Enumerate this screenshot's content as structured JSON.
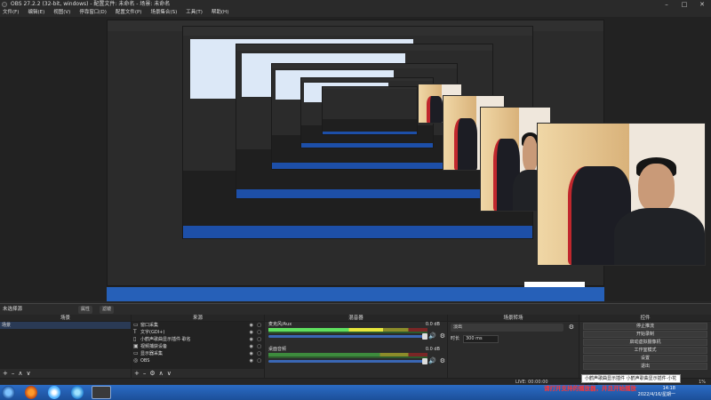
{
  "window": {
    "title": "OBS 27.2.2 (32-bit, windows) - 配置文件: 未命名 - 场景: 未命名"
  },
  "menu": [
    "文件(F)",
    "编辑(E)",
    "视图(V)",
    "停靠窗口(D)",
    "配置文件(P)",
    "场景集合(S)",
    "工具(T)",
    "帮助(H)"
  ],
  "scene_bar": {
    "current": "未选择源",
    "properties_label": "属性",
    "filters_label": "滤镜"
  },
  "scenes": {
    "title": "场景",
    "items": [
      "场景"
    ]
  },
  "sources": {
    "title": "来源",
    "items": [
      {
        "label": "窗口采集",
        "icon": "window-icon"
      },
      {
        "label": "文字(GDI+)",
        "icon": "text-icon"
      },
      {
        "label": "小鹤声歌曲显示插件·歌名",
        "icon": "text-icon"
      },
      {
        "label": "视频捕获设备",
        "icon": "camera-icon"
      },
      {
        "label": "显示器采集",
        "icon": "monitor-icon"
      },
      {
        "label": "OBS",
        "icon": "image-icon"
      }
    ]
  },
  "mixer": {
    "title": "混音器",
    "tracks": [
      {
        "name": "麦克风/Aux",
        "db": "0.0 dB",
        "level": 0.72
      },
      {
        "name": "桌面音频",
        "db": "0.0 dB",
        "level": 0.0
      }
    ]
  },
  "transitions": {
    "title": "场景转场",
    "selected": "淡出",
    "duration_label": "时长",
    "duration_value": "300 ms"
  },
  "controls": {
    "title": "控件",
    "buttons": [
      "停止推流",
      "开始录制",
      "启动虚拟摄像机",
      "工作室模式",
      "设置",
      "退出"
    ]
  },
  "status": {
    "fps": "LIVE: 00:00:00",
    "right_text": "1%",
    "tooltip": "小鹤声歌曲显示插件 小鹤声歌曲显示插件·小花形机器"
  },
  "overlay": {
    "text": "请打开支持的播放器，并且开始播放"
  },
  "clock": {
    "time": "14:18",
    "date": "2022/4/16/星期一"
  },
  "colors": {
    "accent": "#3a67b5",
    "meter_green": "#5fe05f",
    "meter_yellow": "#e6e63c",
    "overlay_red": "#ff3434",
    "taskbar": "#2b6cc5"
  }
}
